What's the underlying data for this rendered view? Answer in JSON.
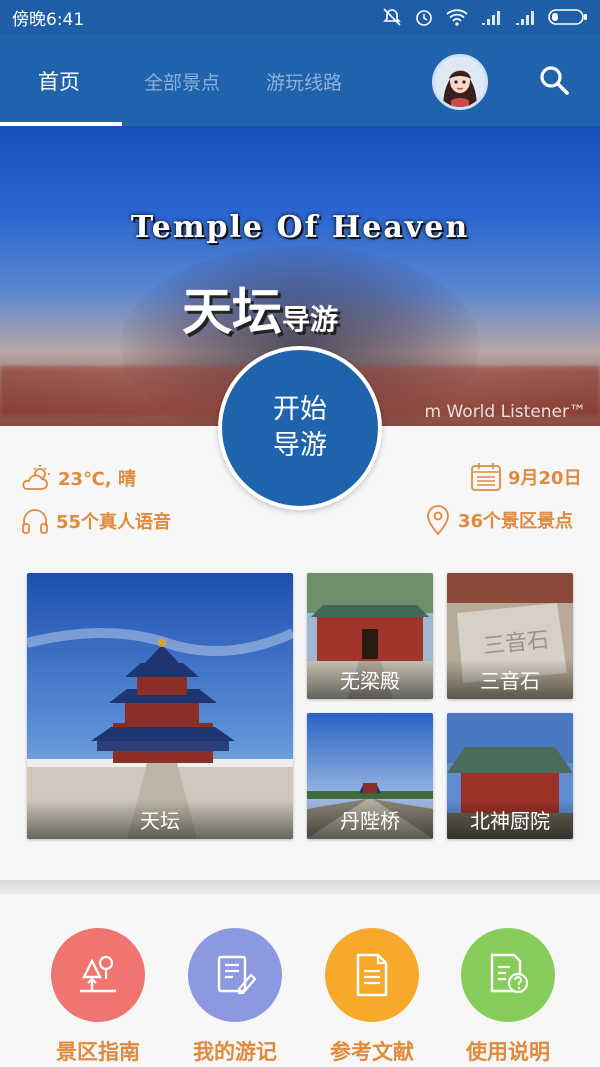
{
  "status_bar": {
    "time": "傍晚6:41"
  },
  "nav": {
    "tabs": [
      {
        "label": "首页",
        "active": true
      },
      {
        "label": "全部景点",
        "active": false
      },
      {
        "label": "游玩线路",
        "active": false
      }
    ],
    "accent": "#1f63ad"
  },
  "banner": {
    "title_en": "Temple Of Heaven",
    "title_cn": "天坛",
    "title_cn_small": "导游",
    "credit": "m World Listener™"
  },
  "start_button": {
    "line1": "开始",
    "line2": "导游"
  },
  "info": {
    "weather": "23℃, 晴",
    "date": "9月20日",
    "audio": "55个真人语音",
    "spots": "36个景区景点",
    "color": "#e08a3c"
  },
  "attractions": [
    {
      "name": "天坛"
    },
    {
      "name": "无梁殿"
    },
    {
      "name": "三音石"
    },
    {
      "name": "丹陛桥"
    },
    {
      "name": "北神厨院"
    }
  ],
  "menu": [
    {
      "label": "景区指南",
      "color": "#f07470",
      "icon": "tree-guide-icon"
    },
    {
      "label": "我的游记",
      "color": "#8c98e0",
      "icon": "notes-icon"
    },
    {
      "label": "参考文献",
      "color": "#f6a92b",
      "icon": "document-icon"
    },
    {
      "label": "使用说明",
      "color": "#86cc5a",
      "icon": "help-document-icon"
    }
  ]
}
